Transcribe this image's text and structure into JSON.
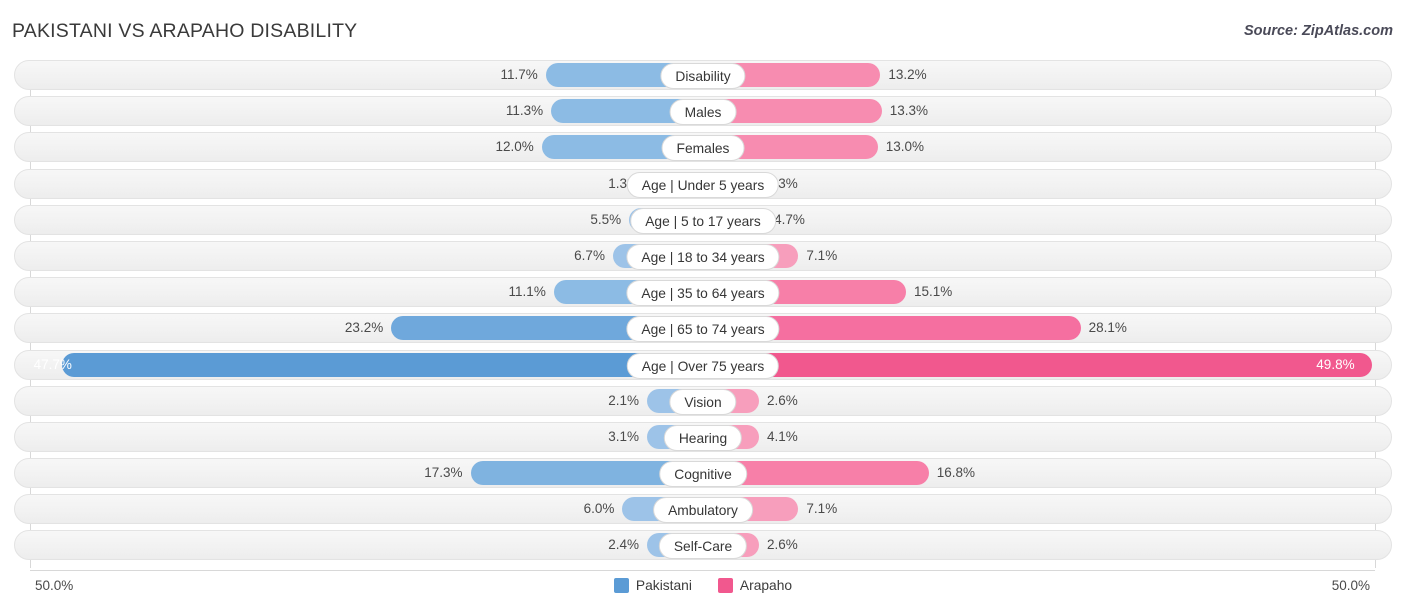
{
  "header": {
    "title": "PAKISTANI VS ARAPAHO DISABILITY",
    "source": "Source: ZipAtlas.com"
  },
  "axis": {
    "left_tick": "50.0%",
    "right_tick": "50.0%"
  },
  "legend": {
    "items": [
      {
        "label": "Pakistani",
        "color": "#5b9bd5"
      },
      {
        "label": "Arapaho",
        "color": "#f1588e"
      }
    ]
  },
  "chart_data": {
    "type": "bar",
    "orientation": "horizontal-diverging",
    "title": "PAKISTANI VS ARAPAHO DISABILITY",
    "xlabel": "",
    "ylabel": "",
    "xlim": [
      50.0,
      50.0
    ],
    "axis_max": 50.0,
    "unit": "%",
    "grid": false,
    "legend_position": "bottom-center",
    "categories": [
      "Disability",
      "Males",
      "Females",
      "Age | Under 5 years",
      "Age | 5 to 17 years",
      "Age | 18 to 34 years",
      "Age | 35 to 64 years",
      "Age | 65 to 74 years",
      "Age | Over 75 years",
      "Vision",
      "Hearing",
      "Cognitive",
      "Ambulatory",
      "Self-Care"
    ],
    "series": [
      {
        "name": "Pakistani",
        "color": "#5b9bd5",
        "values": [
          11.7,
          11.3,
          12.0,
          1.3,
          5.5,
          6.7,
          11.1,
          23.2,
          47.7,
          2.1,
          3.1,
          17.3,
          6.0,
          2.4
        ],
        "labels": [
          "11.7%",
          "11.3%",
          "12.0%",
          "1.3%",
          "5.5%",
          "6.7%",
          "11.1%",
          "23.2%",
          "47.7%",
          "2.1%",
          "3.1%",
          "17.3%",
          "6.0%",
          "2.4%"
        ]
      },
      {
        "name": "Arapaho",
        "color": "#f1588e",
        "values": [
          13.2,
          13.3,
          13.0,
          1.3,
          4.7,
          7.1,
          15.1,
          28.1,
          49.8,
          2.6,
          4.1,
          16.8,
          7.1,
          2.6
        ],
        "labels": [
          "13.2%",
          "13.3%",
          "13.0%",
          "1.3%",
          "4.7%",
          "7.1%",
          "15.1%",
          "28.1%",
          "49.8%",
          "2.6%",
          "4.1%",
          "16.8%",
          "7.1%",
          "2.6%"
        ]
      }
    ]
  }
}
